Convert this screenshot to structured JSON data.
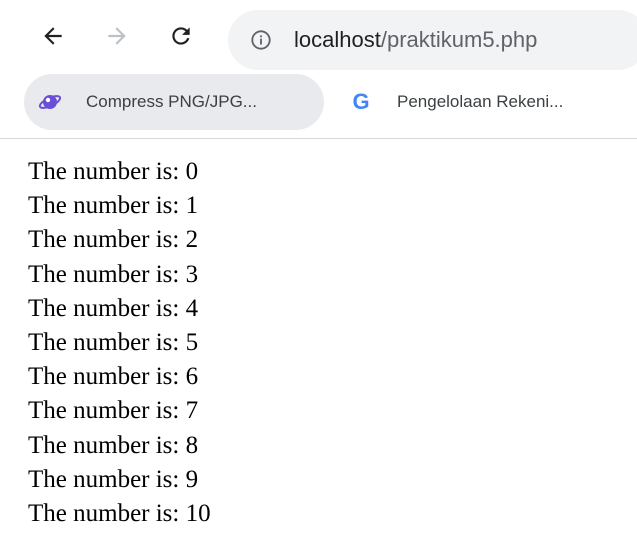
{
  "browser": {
    "url_host": "localhost",
    "url_path": "/praktikum5.php",
    "icons": {
      "back": "arrow-left-icon",
      "forward": "arrow-right-icon",
      "reload": "reload-icon",
      "site_info": "info-icon"
    }
  },
  "bookmarks": [
    {
      "label": "Compress PNG/JPG...",
      "icon": "compress-png-favicon"
    },
    {
      "label": "Pengelolaan Rekeni...",
      "icon": "google-g-icon",
      "icon_glyph": "G"
    }
  ],
  "content": {
    "lines": [
      "The number is: 0",
      "The number is: 1",
      "The number is: 2",
      "The number is: 3",
      "The number is: 4",
      "The number is: 5",
      "The number is: 6",
      "The number is: 7",
      "The number is: 8",
      "The number is: 9",
      "The number is: 10"
    ]
  },
  "colors": {
    "omnibox_bg": "#f1f3f4",
    "bookmark_active_bg": "#e8eaed",
    "icon": "#5f6368",
    "forward_disabled": "#bdc1c6",
    "google_blue": "#4285f4",
    "favicon_purple": "#6a4fd6"
  }
}
